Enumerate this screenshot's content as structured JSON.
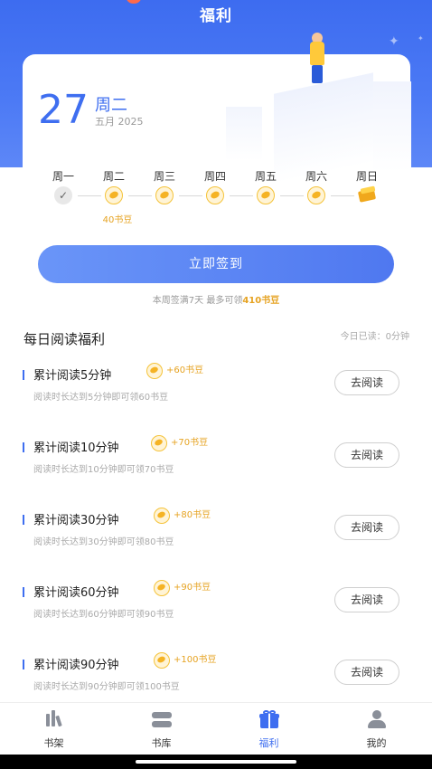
{
  "header": {
    "title": "福利"
  },
  "date_card": {
    "day": "27",
    "weekday": "周二",
    "month_year": "五月 2025"
  },
  "week": {
    "days": [
      "周一",
      "周二",
      "周三",
      "周四",
      "周五",
      "周六",
      "周日"
    ],
    "today_reward": "40书豆"
  },
  "signin": {
    "button_label": "立即签到",
    "note_prefix": "本周签满7天 最多可领",
    "note_highlight": "410书豆"
  },
  "daily_reading": {
    "title": "每日阅读福利",
    "today_read": "今日已读：0分钟",
    "tasks": [
      {
        "name": "累计阅读5分钟",
        "reward": "+60书豆",
        "desc": "阅读时长达到5分钟即可领60书豆",
        "button": "去阅读"
      },
      {
        "name": "累计阅读10分钟",
        "reward": "+70书豆",
        "desc": "阅读时长达到10分钟即可领70书豆",
        "button": "去阅读"
      },
      {
        "name": "累计阅读30分钟",
        "reward": "+80书豆",
        "desc": "阅读时长达到30分钟即可领80书豆",
        "button": "去阅读"
      },
      {
        "name": "累计阅读60分钟",
        "reward": "+90书豆",
        "desc": "阅读时长达到60分钟即可领90书豆",
        "button": "去阅读"
      },
      {
        "name": "累计阅读90分钟",
        "reward": "+100书豆",
        "desc": "阅读时长达到90分钟即可领100书豆",
        "button": "去阅读"
      }
    ]
  },
  "nav": {
    "items": [
      {
        "label": "书架",
        "icon": "bookshelf-icon"
      },
      {
        "label": "书库",
        "icon": "library-icon"
      },
      {
        "label": "福利",
        "icon": "gift-icon",
        "active": true
      },
      {
        "label": "我的",
        "icon": "profile-icon"
      }
    ]
  },
  "colors": {
    "accent": "#3e6ef0",
    "reward": "#e6a322"
  }
}
